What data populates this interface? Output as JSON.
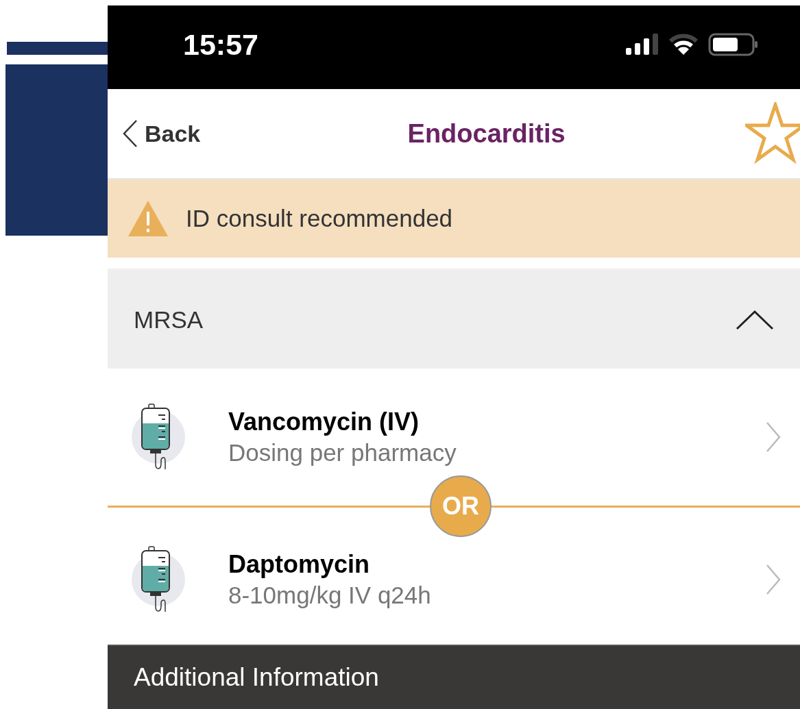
{
  "status_bar": {
    "time": "15:57"
  },
  "nav": {
    "back": "Back",
    "title": "Endocarditis",
    "favorite": false
  },
  "alert": {
    "text": "ID consult recommended"
  },
  "section": {
    "title": "MRSA",
    "expanded": true,
    "drugs": [
      {
        "name": "Vancomycin (IV)",
        "dose": "Dosing per pharmacy"
      },
      {
        "name": "Daptomycin",
        "dose": "8-10mg/kg IV q24h"
      }
    ],
    "separator": "OR"
  },
  "footer": {
    "title": "Additional Information"
  }
}
